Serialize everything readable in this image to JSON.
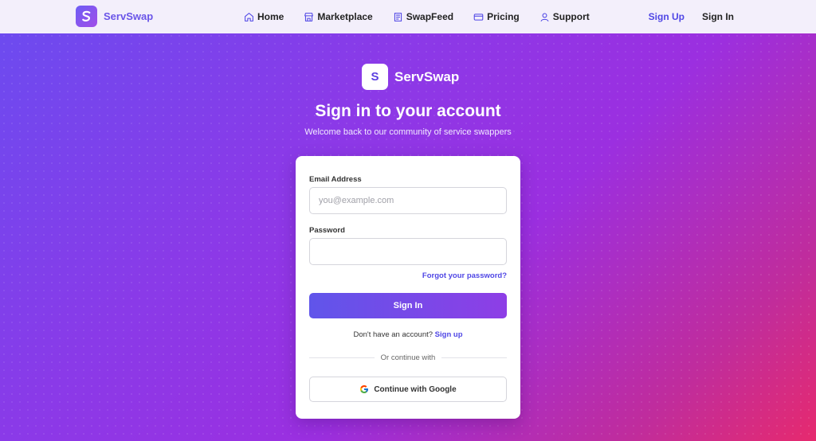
{
  "nav": {
    "brand": "ServSwap",
    "links": [
      {
        "label": "Home",
        "icon": "home-icon"
      },
      {
        "label": "Marketplace",
        "icon": "store-icon"
      },
      {
        "label": "SwapFeed",
        "icon": "newspaper-icon"
      },
      {
        "label": "Pricing",
        "icon": "credit-card-icon"
      },
      {
        "label": "Support",
        "icon": "user-icon"
      }
    ],
    "signup": "Sign Up",
    "signin": "Sign In"
  },
  "hero": {
    "logo_letter": "S",
    "brand": "ServSwap",
    "title": "Sign in to your account",
    "subtitle": "Welcome back to our community of service swappers"
  },
  "form": {
    "email_label": "Email Address",
    "email_placeholder": "you@example.com",
    "email_value": "",
    "password_label": "Password",
    "password_value": "",
    "forgot": "Forgot your password?",
    "submit": "Sign In",
    "no_account": "Don't have an account?",
    "signup_link": "Sign up",
    "divider": "Or continue with",
    "google": "Continue with Google"
  },
  "colors": {
    "accent": "#4f46e5",
    "brand": "#6a55e8",
    "gradient_start": "#6a4cf0",
    "gradient_end": "#e62a6e"
  }
}
